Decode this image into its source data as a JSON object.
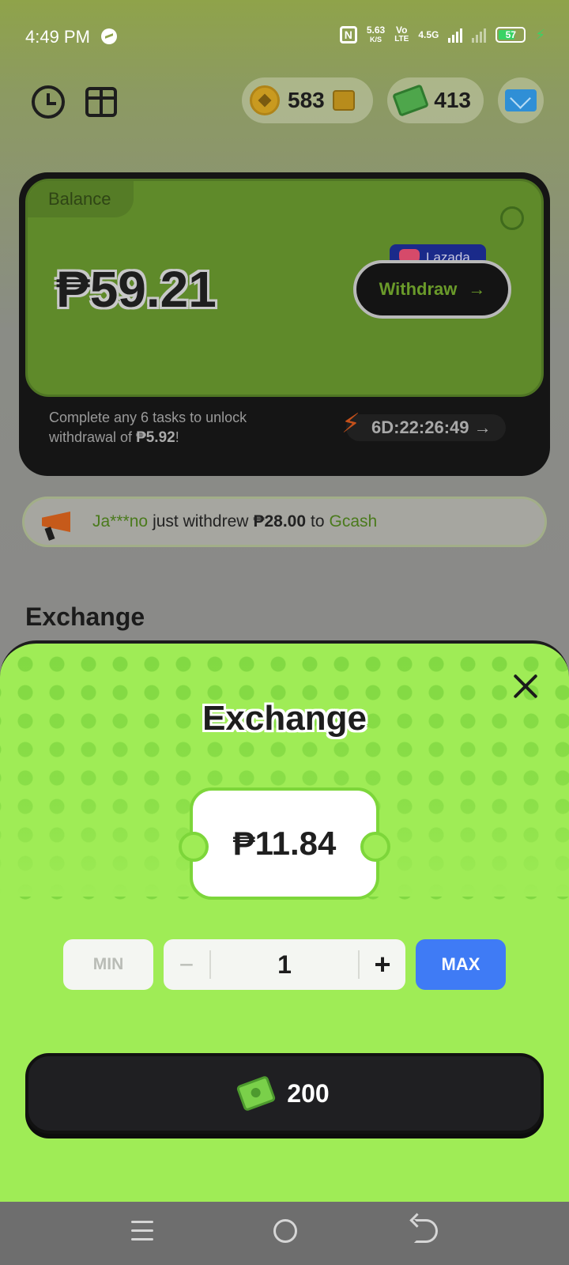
{
  "status_bar": {
    "time": "4:49 PM",
    "net_speed": "5.63",
    "net_speed_unit": "K/S",
    "volte": "Vo",
    "lte": "LTE",
    "network": "4.5G",
    "battery": "57"
  },
  "header": {
    "coins": "583",
    "cash": "413"
  },
  "balance_card": {
    "tag": "Balance",
    "amount": "₱59.21",
    "lazada_label": "Lazada",
    "withdraw_label": "Withdraw",
    "withdraw_arrow": "→",
    "task_line1": "Complete any 6 tasks to unlock",
    "task_line2_prefix": "withdrawal of ",
    "task_amount": "₱5.92",
    "task_suffix": "!",
    "timer": "6D:22:26:49 →"
  },
  "ticker": {
    "user": "Ja***no",
    "text": "just withdrew",
    "amount": "₱28.00",
    "to": "to",
    "method": "Gcash"
  },
  "section_heading": "Exchange",
  "sheet": {
    "title": "Exchange",
    "ticket_value": "₱11.84",
    "min_label": "MIN",
    "minus_label": "−",
    "quantity": "1",
    "plus_label": "+",
    "max_label": "MAX",
    "confirm_cost": "200"
  },
  "colors": {
    "sheet_bg": "#9fec56",
    "max_button": "#3f7bf5",
    "confirm_button": "#1f1f22",
    "accent_green": "#4a7a1c"
  },
  "icons": [
    "messenger-icon",
    "nfc-icon",
    "signal-icon",
    "battery-icon",
    "history-icon",
    "gift-icon",
    "coin-icon",
    "chest-icon",
    "cash-icon",
    "mail-icon",
    "lazada-icon",
    "lightning-icon",
    "megaphone-icon",
    "close-icon",
    "menu-icon",
    "home-icon",
    "back-icon"
  ]
}
